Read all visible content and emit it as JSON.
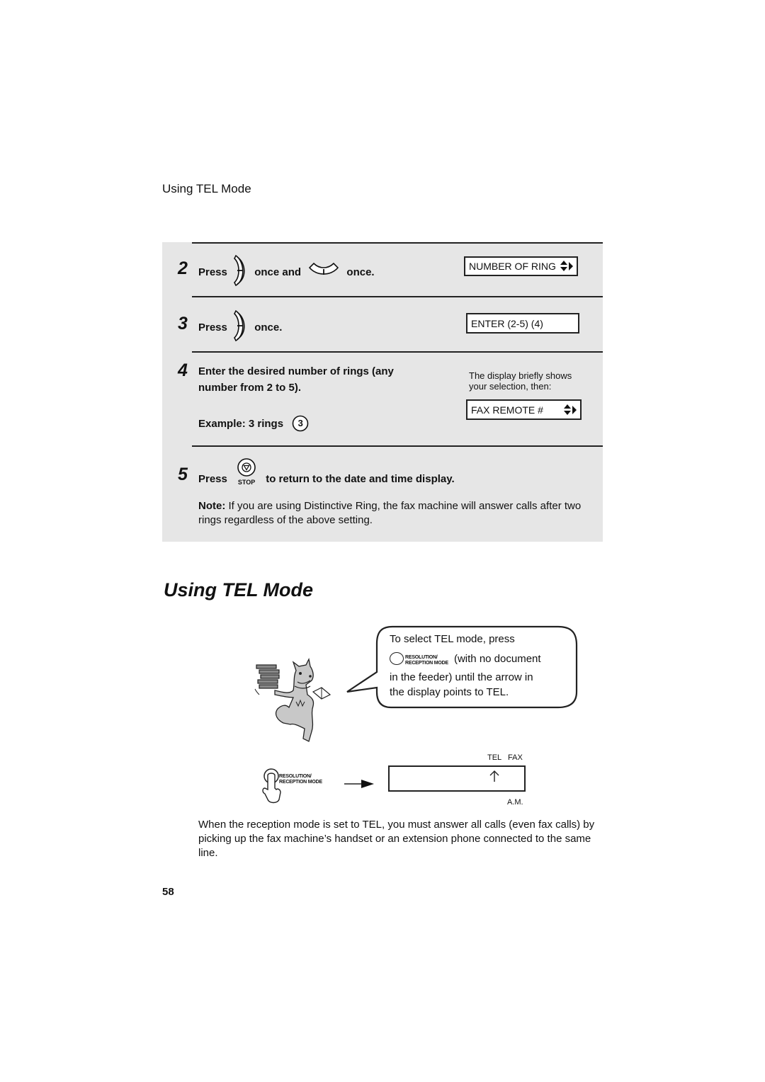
{
  "running_head": "Using TEL Mode",
  "steps": [
    {
      "number": "2",
      "press": "Press",
      "mid": "once and",
      "end": "once.",
      "display": "NUMBER OF RING"
    },
    {
      "number": "3",
      "press": "Press",
      "end": "once.",
      "display": "ENTER (2-5) (4)"
    },
    {
      "number": "4",
      "line1": "Enter the desired number of rings (any",
      "line2": "number from 2 to 5).",
      "example_label": "Example: 3 rings",
      "example_key": "3",
      "side_note_line1": "The display briefly shows",
      "side_note_line2": "your selection, then:",
      "display": "FAX REMOTE #"
    },
    {
      "number": "5",
      "press": "Press",
      "key_label": "STOP",
      "end": "to return to the date and time display.",
      "note_label": "Note:",
      "note_text": " If you are using Distinctive Ring, the fax machine will answer calls after two rings regardless of the above setting."
    }
  ],
  "section_title": "Using TEL Mode",
  "bubble": {
    "line1": "To select TEL mode, press",
    "key_label_1": "RESOLUTION/",
    "key_label_2": "RECEPTION MODE",
    "line2_after_key": "(with no document",
    "line3": "in the feeder) until the arrow in",
    "line4": "the display points to TEL."
  },
  "illustration": {
    "key_label_1": "RESOLUTION/",
    "key_label_2": "RECEPTION MODE",
    "display_labels": [
      "TEL",
      "FAX"
    ],
    "display_bottom_label": "A.M."
  },
  "body_paragraph": "When the reception mode is set to TEL, you must answer all calls (even fax calls) by picking up the fax machine’s handset or an extension phone connected to the same line.",
  "page_number": "58"
}
